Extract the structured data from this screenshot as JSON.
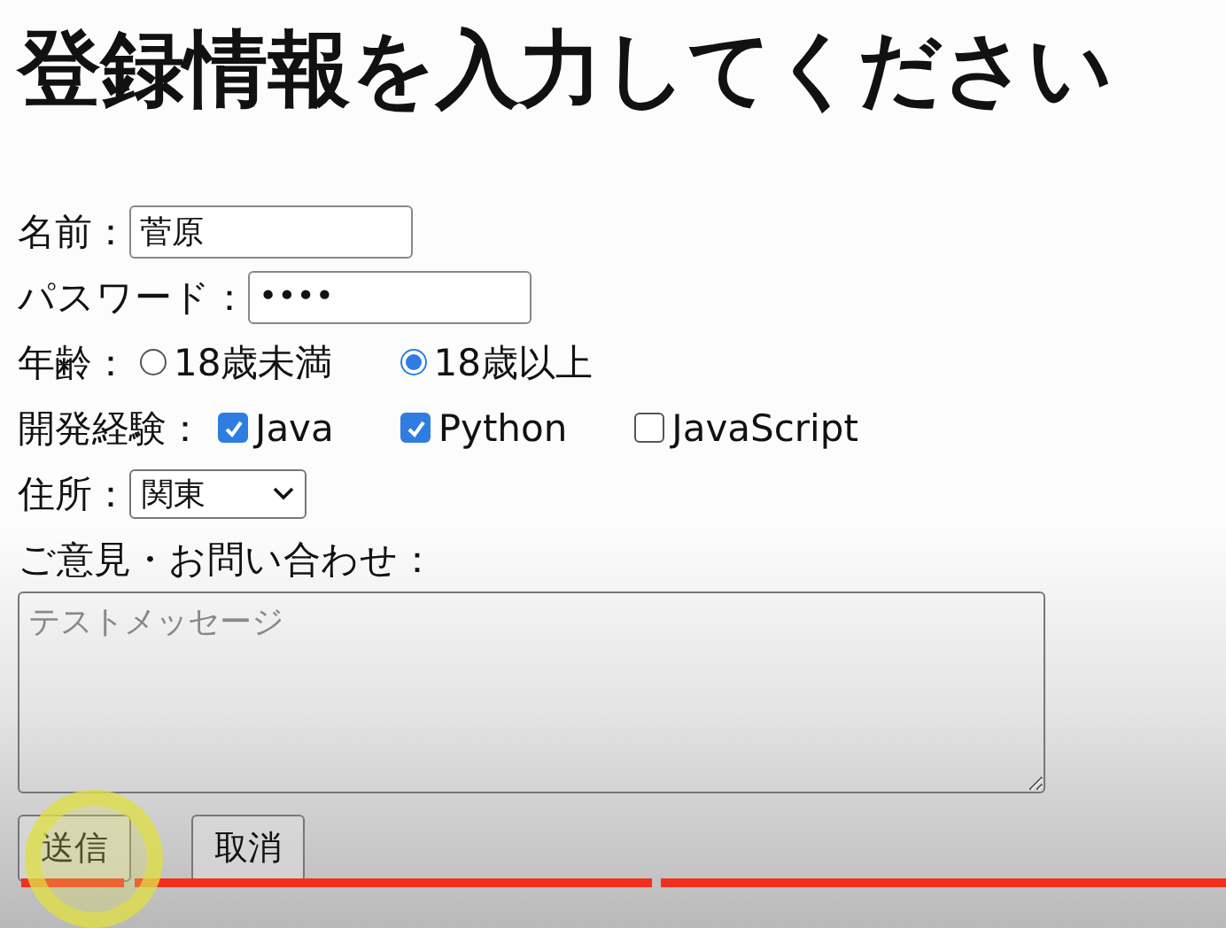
{
  "title": "登録情報を入力してください",
  "form": {
    "name": {
      "label": "名前：",
      "value": "菅原"
    },
    "password": {
      "label": "パスワード：",
      "value": "••••"
    },
    "age": {
      "label": "年齢：",
      "options": [
        {
          "label": "18歳未満",
          "selected": false
        },
        {
          "label": "18歳以上",
          "selected": true
        }
      ]
    },
    "experience": {
      "label": "開発経験：",
      "options": [
        {
          "label": "Java",
          "checked": true
        },
        {
          "label": "Python",
          "checked": true
        },
        {
          "label": "JavaScript",
          "checked": false
        }
      ]
    },
    "address": {
      "label": "住所：",
      "value": "関東"
    },
    "inquiry": {
      "label": "ご意見・お問い合わせ：",
      "placeholder": "テストメッセージ"
    },
    "buttons": [
      "送信",
      "取消"
    ]
  },
  "video_progress": {
    "level": 1
  }
}
